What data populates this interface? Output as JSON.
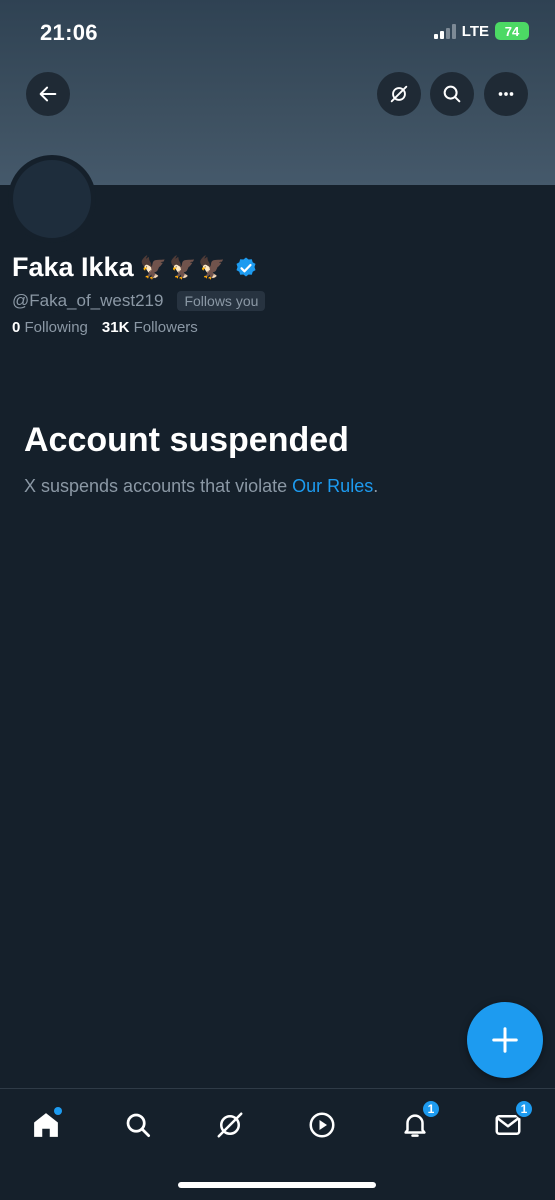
{
  "status_bar": {
    "time": "21:06",
    "network": "LTE",
    "battery": "74"
  },
  "header": {
    "back_icon": "arrow-left-icon",
    "grok_icon": "grok-icon",
    "search_icon": "search-icon",
    "more_icon": "more-horizontal-icon"
  },
  "profile": {
    "display_name": "Faka Ikka",
    "name_emoji": "🦅🦅🦅",
    "verified": true,
    "handle": "@Faka_of_west219",
    "follows_you_label": "Follows you",
    "following_count": "0",
    "following_label": "Following",
    "followers_count": "31K",
    "followers_label": "Followers"
  },
  "suspension": {
    "title": "Account suspended",
    "text": "X suspends accounts that violate ",
    "link_text": "Our Rules",
    "suffix": "."
  },
  "fab": {
    "icon": "plus-icon"
  },
  "bottom_nav": {
    "items": [
      {
        "name": "home",
        "icon": "home-icon",
        "dot": true
      },
      {
        "name": "search",
        "icon": "search-icon"
      },
      {
        "name": "grok",
        "icon": "grok-icon"
      },
      {
        "name": "video",
        "icon": "play-circle-icon"
      },
      {
        "name": "notifications",
        "icon": "bell-icon",
        "badge": "1"
      },
      {
        "name": "messages",
        "icon": "mail-icon",
        "badge": "1"
      }
    ]
  },
  "colors": {
    "accent": "#1d9bf0",
    "background": "#15202b",
    "secondary_text": "#8b98a5",
    "battery": "#4cd964"
  }
}
